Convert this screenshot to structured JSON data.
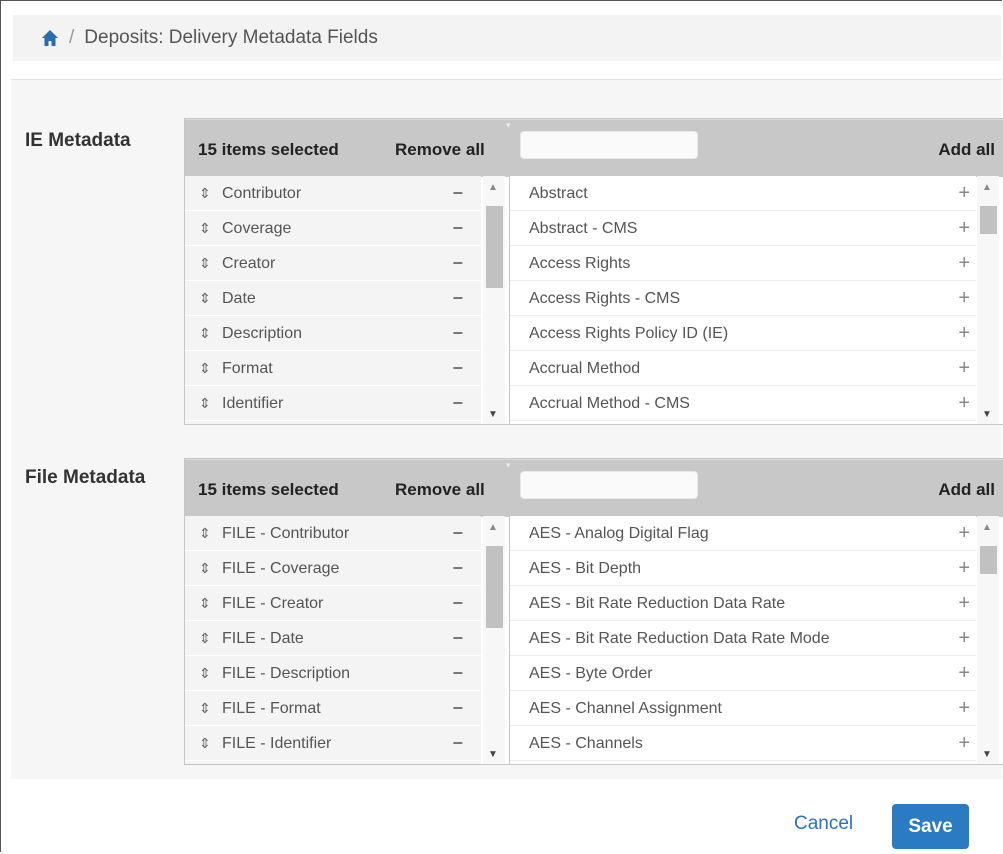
{
  "breadcrumb": {
    "home_icon": "home-icon",
    "separator": "/",
    "title": "Deposits: Delivery Metadata Fields"
  },
  "colors": {
    "accent": "#2b7bc2",
    "link": "#2b71c6",
    "header": "#c8c8c8"
  },
  "ie_metadata": {
    "label": "IE Metadata",
    "selected_count": "15 items selected",
    "remove_all": "Remove all",
    "add_all": "Add all",
    "search_value": "",
    "selected": [
      "Contributor",
      "Coverage",
      "Creator",
      "Date",
      "Description",
      "Format",
      "Identifier"
    ],
    "available": [
      "Abstract",
      "Abstract - CMS",
      "Access Rights",
      "Access Rights - CMS",
      "Access Rights Policy ID (IE)",
      "Accrual Method",
      "Accrual Method - CMS"
    ]
  },
  "file_metadata": {
    "label": "File Metadata",
    "selected_count": "15 items selected",
    "remove_all": "Remove all",
    "add_all": "Add all",
    "search_value": "",
    "selected": [
      "FILE - Contributor",
      "FILE - Coverage",
      "FILE - Creator",
      "FILE - Date",
      "FILE - Description",
      "FILE - Format",
      "FILE - Identifier"
    ],
    "available": [
      "AES - Analog Digital Flag",
      "AES - Bit Depth",
      "AES - Bit Rate Reduction Data Rate",
      "AES - Bit Rate Reduction Data Rate Mode",
      "AES - Byte Order",
      "AES - Channel Assignment",
      "AES - Channels"
    ]
  },
  "glyphs": {
    "grip": "⇕",
    "minus": "−",
    "plus": "+",
    "up": "▲",
    "down": "▼"
  },
  "footer": {
    "cancel": "Cancel",
    "save": "Save"
  }
}
